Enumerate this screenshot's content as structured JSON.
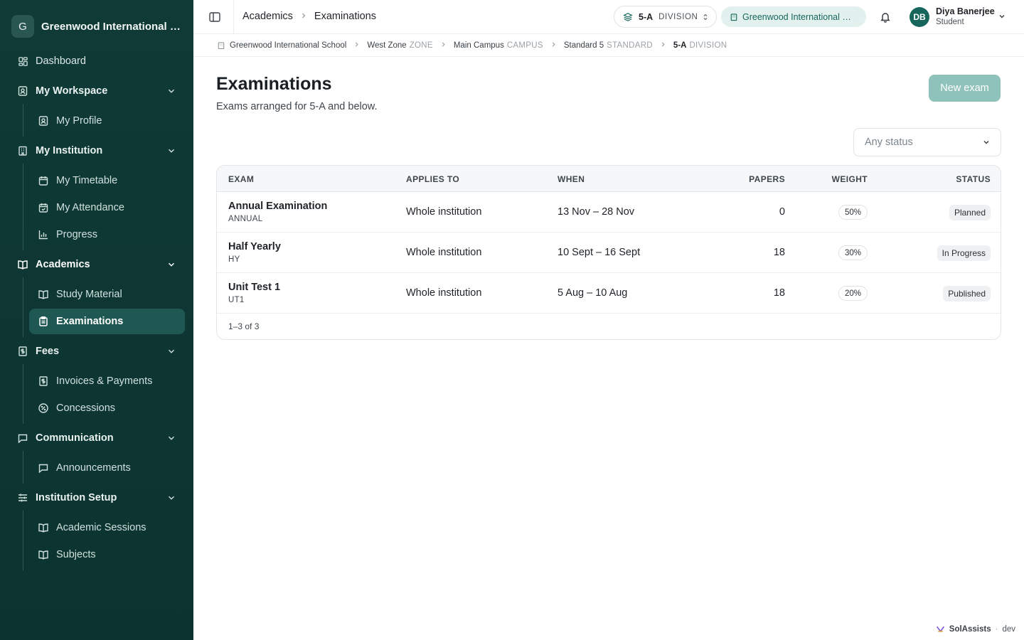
{
  "sidebar": {
    "brand_initial": "G",
    "brand_name": "Greenwood International School",
    "items": {
      "dashboard": "Dashboard",
      "workspace": "My Workspace",
      "profile": "My Profile",
      "institution": "My Institution",
      "timetable": "My Timetable",
      "attendance": "My Attendance",
      "progress": "Progress",
      "academics": "Academics",
      "study_material": "Study Material",
      "examinations": "Examinations",
      "fees": "Fees",
      "invoices": "Invoices & Payments",
      "concessions": "Concessions",
      "communication": "Communication",
      "announcements": "Announcements",
      "setup": "Institution Setup",
      "sessions": "Academic Sessions",
      "subjects": "Subjects"
    }
  },
  "topbar": {
    "crumb_parent": "Academics",
    "crumb_current": "Examinations",
    "scope_code": "5-A",
    "scope_kind": "DIVISION",
    "institution": "Greenwood International School",
    "user_initials": "DB",
    "user_name": "Diya Banerjee",
    "user_role": "Student"
  },
  "scope_path": [
    {
      "name": "Greenwood International School",
      "level": ""
    },
    {
      "name": "West Zone",
      "level": "ZONE"
    },
    {
      "name": "Main Campus",
      "level": "CAMPUS"
    },
    {
      "name": "Standard 5",
      "level": "STANDARD"
    },
    {
      "name": "5-A",
      "level": "DIVISION"
    }
  ],
  "main": {
    "title": "Examinations",
    "subtitle": "Exams arranged for 5-A and below.",
    "new_button": "New exam",
    "status_filter_placeholder": "Any status"
  },
  "table": {
    "headers": {
      "exam": "EXAM",
      "applies": "APPLIES TO",
      "when": "WHEN",
      "papers": "PAPERS",
      "weight": "WEIGHT",
      "status": "STATUS"
    },
    "rows": [
      {
        "name": "Annual Examination",
        "code": "ANNUAL",
        "applies": "Whole institution",
        "when": "13 Nov – 28 Nov",
        "papers": "0",
        "weight": "50%",
        "status": "Planned"
      },
      {
        "name": "Half Yearly",
        "code": "HY",
        "applies": "Whole institution",
        "when": "10 Sept – 16 Sept",
        "papers": "18",
        "weight": "30%",
        "status": "In Progress"
      },
      {
        "name": "Unit Test 1",
        "code": "UT1",
        "applies": "Whole institution",
        "when": "5 Aug – 10 Aug",
        "papers": "18",
        "weight": "20%",
        "status": "Published"
      }
    ],
    "footer": "1–3 of 3"
  },
  "devtag": {
    "brand": "SolAssists",
    "env": "dev"
  }
}
